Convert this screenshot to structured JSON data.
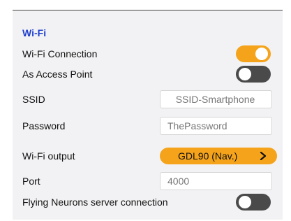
{
  "colors": {
    "accent": "#f5a31a",
    "toggle_off": "#4a4a4a",
    "section_title": "#1f3fcf"
  },
  "wifi": {
    "section_title": "Wi-Fi",
    "connection": {
      "label": "Wi-Fi Connection",
      "state": "on"
    },
    "access_point": {
      "label": "As Access Point",
      "state": "off"
    },
    "ssid": {
      "label": "SSID",
      "value": "SSID-Smartphone"
    },
    "password": {
      "label": "Password",
      "value": "ThePassword"
    },
    "output": {
      "label": "Wi-Fi output",
      "value": "GDL90 (Nav.)",
      "icon": "chevron-right-icon"
    },
    "port": {
      "label": "Port",
      "value": "4000"
    },
    "flying_neurons": {
      "label": "Flying Neurons server connection",
      "state": "off"
    }
  }
}
